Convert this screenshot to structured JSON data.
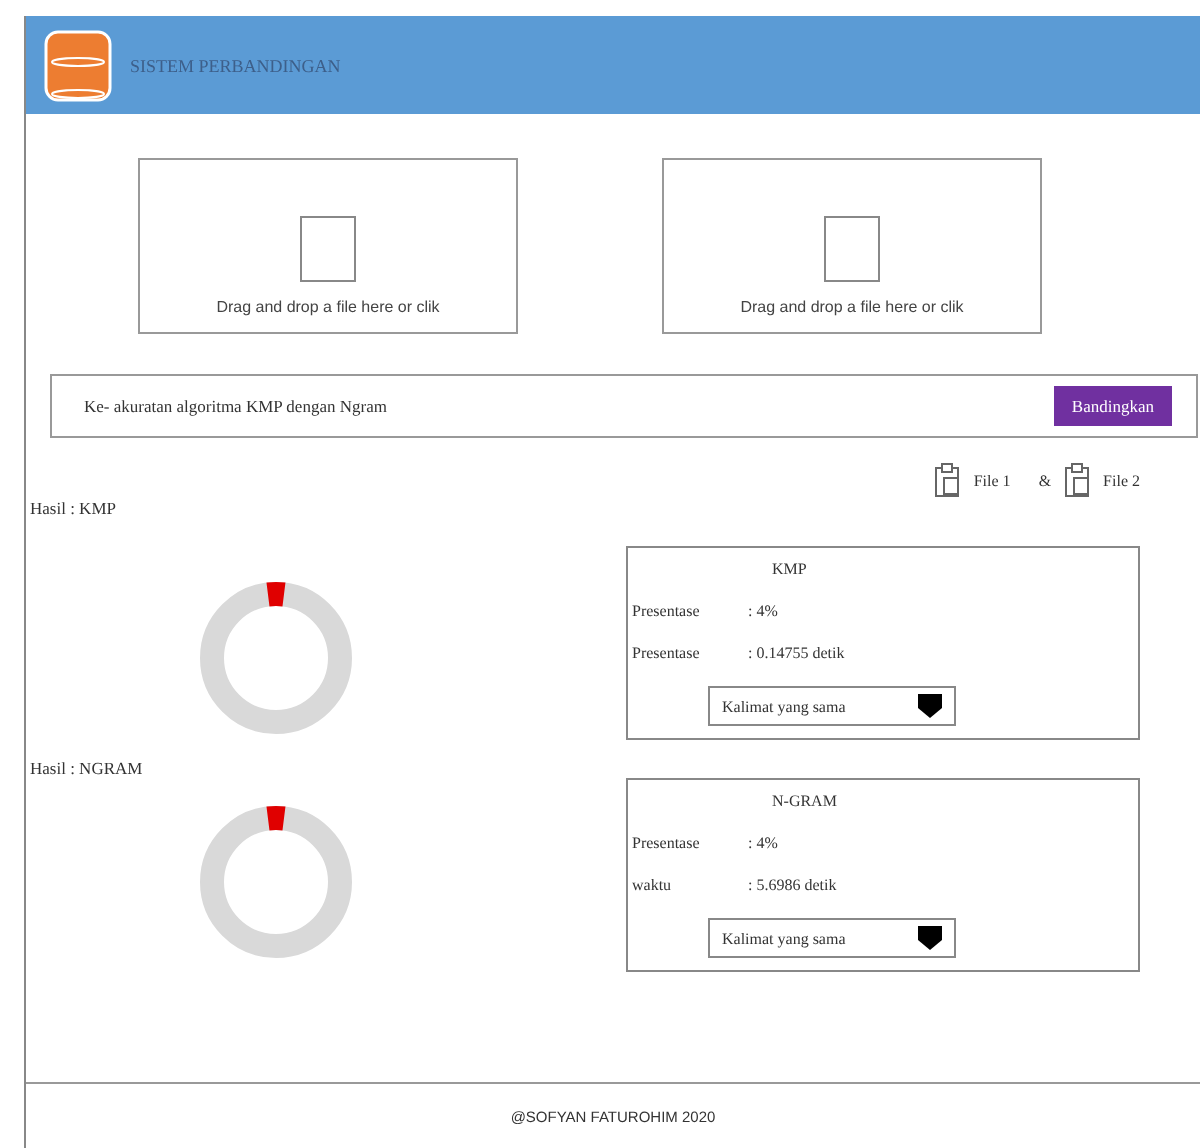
{
  "header": {
    "title": "SISTEM PERBANDINGAN"
  },
  "dropzones": [
    {
      "label": "Drag and drop a file here or clik"
    },
    {
      "label": "Drag and drop a file here or clik"
    }
  ],
  "compare_bar": {
    "text": "Ke- akuratan algoritma KMP dengan Ngram",
    "button": "Bandingkan"
  },
  "files": {
    "file_1": "File 1",
    "separator": "&",
    "file_2": "File 2"
  },
  "results": [
    {
      "heading": "Hasil : KMP",
      "level": 0.04,
      "card_title": "KMP",
      "rows": [
        {
          "label": "Presentase",
          "value": ": 4%"
        },
        {
          "label": "Presentase",
          "value": ": 0.14755 detik"
        }
      ],
      "dropdown": "Kalimat yang sama"
    },
    {
      "heading": "Hasil : NGRAM",
      "level": 0.04,
      "card_title": "N-GRAM",
      "rows": [
        {
          "label": "Presentase",
          "value": ": 4%"
        },
        {
          "label": "waktu",
          "value": ": 5.6986 detik"
        }
      ],
      "dropdown": "Kalimat yang sama"
    }
  ],
  "footer": "@SOFYAN FATUROHIM 2020"
}
